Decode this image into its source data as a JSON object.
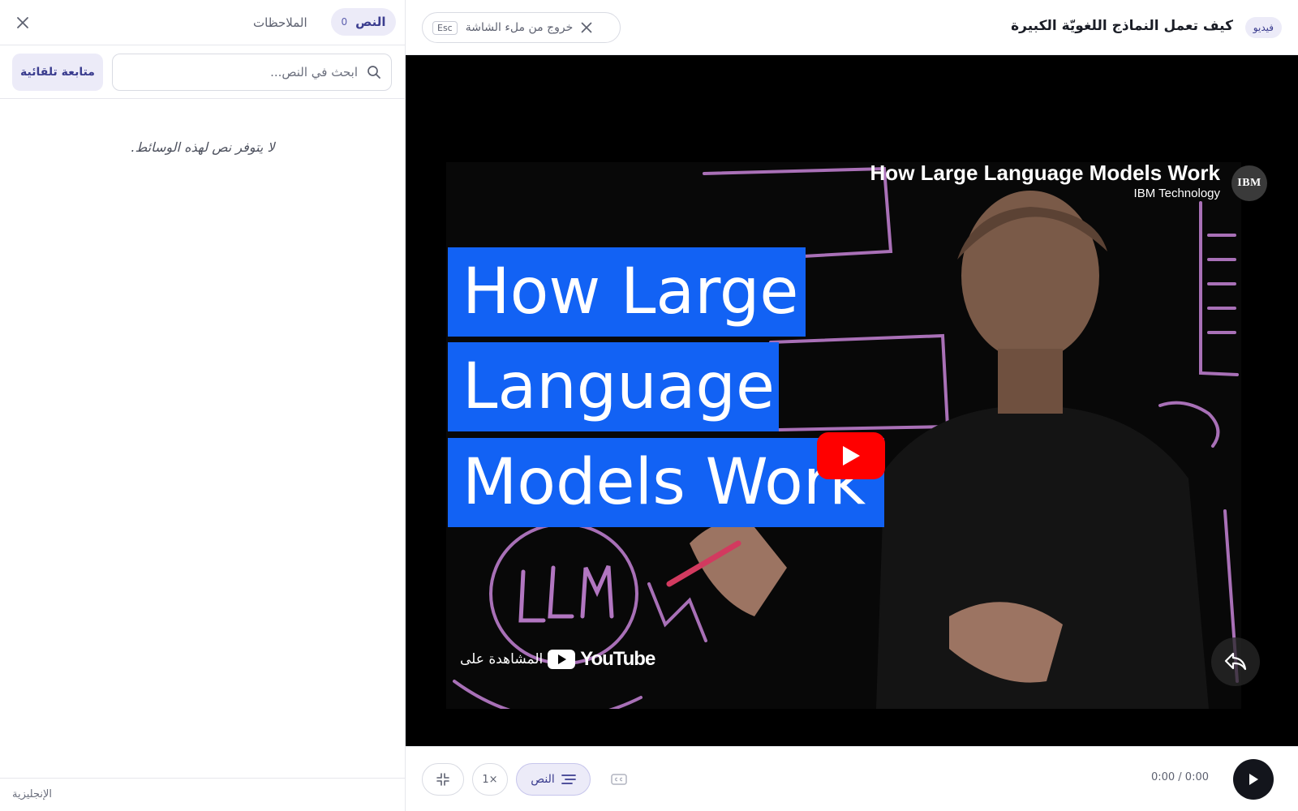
{
  "topbar": {
    "type_badge": "فيديو",
    "title": "كيف تعمل النماذج اللغويّة الكبيرة",
    "exit_fullscreen_label": "خروج من ملء الشاشة",
    "esc_key": "Esc"
  },
  "panel": {
    "tabs": {
      "transcript_label": "النص",
      "transcript_count": "0",
      "notes_label": "الملاحظات"
    },
    "search_placeholder": "ابحث في النص...",
    "search_value": "",
    "autofollow_label": "متابعة تلقائية",
    "empty_message": "لا يتوفر نص لهذه الوسائط.",
    "language": "الإنجليزية"
  },
  "video": {
    "youtube_title": "How Large Language Models Work",
    "channel": "IBM Technology",
    "channel_logo": "IBM",
    "thumbnail_lines": [
      "How Large",
      "Language",
      "Models Work"
    ],
    "whiteboard_word": "LLM",
    "watch_on_label": "المشاهدة على",
    "youtube_wordmark": "YouTube"
  },
  "controls": {
    "speed": "1×",
    "transcript_label": "النص",
    "time": "0:00 / 0:00"
  },
  "colors": {
    "accent": "#3b3d8f",
    "accent_bg": "#ecebf8",
    "thumbnail_blue": "#1262f4",
    "youtube_red": "#ff0000"
  },
  "icons": [
    "close-icon",
    "search-icon",
    "play-icon",
    "share-icon",
    "compress-icon",
    "captions-icon",
    "lines-icon",
    "youtube-logo-icon"
  ]
}
